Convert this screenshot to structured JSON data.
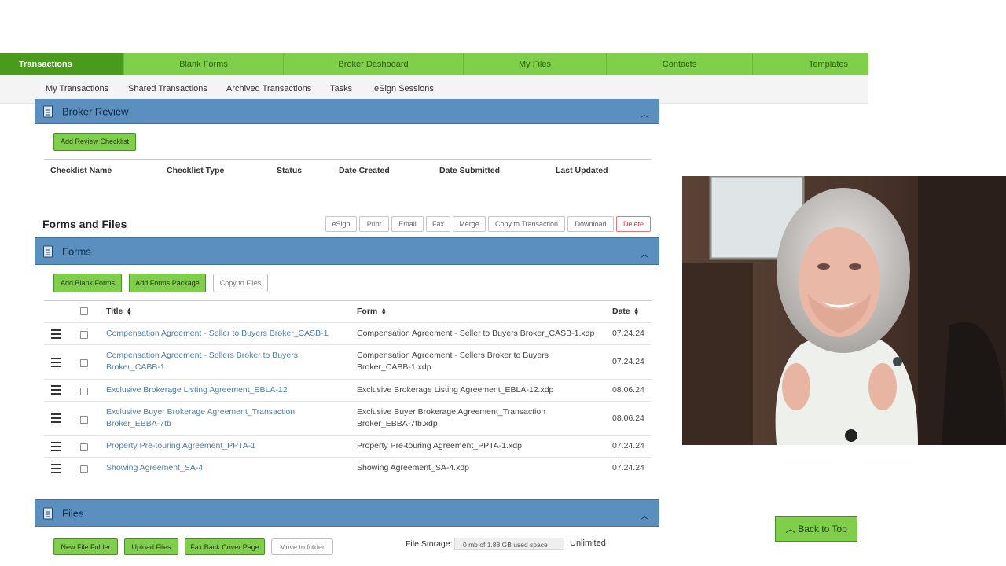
{
  "nav": {
    "tabs": [
      {
        "label": "Transactions",
        "active": true
      },
      {
        "label": "Blank Forms"
      },
      {
        "label": "Broker Dashboard"
      },
      {
        "label": "My Files"
      },
      {
        "label": "Contacts"
      },
      {
        "label": "Templates"
      }
    ],
    "subnav": [
      "My Transactions",
      "Shared Transactions",
      "Archived Transactions",
      "Tasks",
      "eSign Sessions"
    ]
  },
  "broker_review": {
    "title": "Broker Review",
    "add_button": "Add Review Checklist",
    "columns": [
      "Checklist Name",
      "Checklist Type",
      "Status",
      "Date Created",
      "Date Submitted",
      "Last Updated"
    ]
  },
  "forms_files": {
    "heading": "Forms and Files",
    "actions": [
      "eSign",
      "Print",
      "Email",
      "Fax",
      "Merge",
      "Copy to Transaction",
      "Download",
      "Delete"
    ]
  },
  "forms": {
    "title": "Forms",
    "buttons": {
      "add_blank": "Add Blank Forms",
      "add_package": "Add Forms Package",
      "copy_files": "Copy to Files"
    },
    "columns": {
      "title": "Title",
      "form": "Form",
      "date": "Date"
    },
    "rows": [
      {
        "title": "Compensation Agreement - Seller to Buyers Broker_CASB-1",
        "form": "Compensation Agreement - Seller to Buyers Broker_CASB-1.xdp",
        "date": "07.24.24"
      },
      {
        "title": "Compensation Agreement - Sellers Broker to Buyers Broker_CABB-1",
        "form": "Compensation Agreement - Sellers Broker to Buyers Broker_CABB-1.xdp",
        "date": "07.24.24"
      },
      {
        "title": "Exclusive Brokerage Listing Agreement_EBLA-12",
        "form": "Exclusive Brokerage Listing Agreement_EBLA-12.xdp",
        "date": "08.06.24"
      },
      {
        "title": "Exclusive Buyer Brokerage Agreement_Transaction Broker_EBBA-7tb",
        "form": "Exclusive Buyer Brokerage Agreement_Transaction Broker_EBBA-7tb.xdp",
        "date": "08.06.24"
      },
      {
        "title": "Property Pre-touring Agreement_PPTA-1",
        "form": "Property Pre-touring Agreement_PPTA-1.xdp",
        "date": "07.24.24"
      },
      {
        "title": "Showing Agreement_SA-4",
        "form": "Showing Agreement_SA-4.xdp",
        "date": "07.24.24"
      }
    ]
  },
  "files": {
    "title": "Files",
    "buttons": {
      "new_folder": "New File Folder",
      "upload": "Upload Files",
      "fax_cover": "Fax Back Cover Page",
      "move": "Move to folder"
    },
    "storage_label": "File Storage:",
    "storage_value": "0 mb of 1.88 GB used space",
    "storage_limit": "Unlimited"
  },
  "back_to_top": "Back to Top",
  "icons": {
    "section": "document-icon",
    "collapse": "chevron-up-icon",
    "sort": "sort-icon",
    "drag": "drag-handle-icon",
    "back_to_top": "chevron-up-icon"
  },
  "colors": {
    "nav_green": "#7fcf4a",
    "nav_active": "#4a9a1c",
    "section_blue": "#5b8fc0",
    "link": "#4d7ea8",
    "delete": "#d9363e"
  }
}
